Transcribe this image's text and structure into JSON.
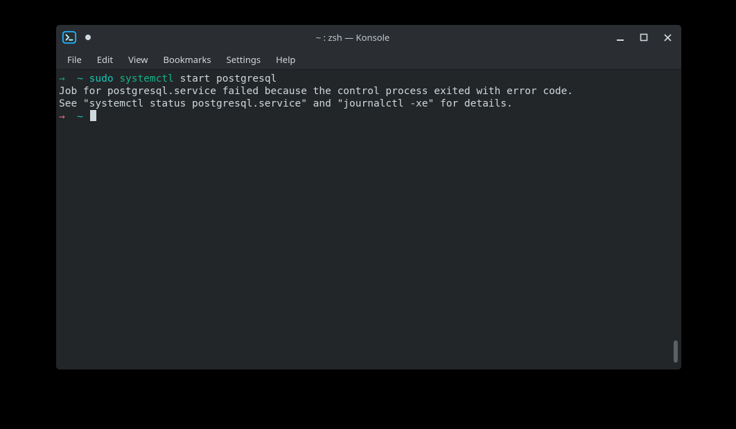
{
  "title": "~ : zsh — Konsole",
  "menubar": {
    "file": "File",
    "edit": "Edit",
    "view": "View",
    "bookmarks": "Bookmarks",
    "settings": "Settings",
    "help": "Help"
  },
  "prompt": {
    "arrow": "→",
    "tilde": "~"
  },
  "line1": {
    "sudo": "sudo",
    "systemctl": "systemctl",
    "rest": "start postgresql"
  },
  "output": {
    "l1": "Job for postgresql.service failed because the control process exited with error code.",
    "l2": "See \"systemctl status postgresql.service\" and \"journalctl -xe\" for details."
  }
}
